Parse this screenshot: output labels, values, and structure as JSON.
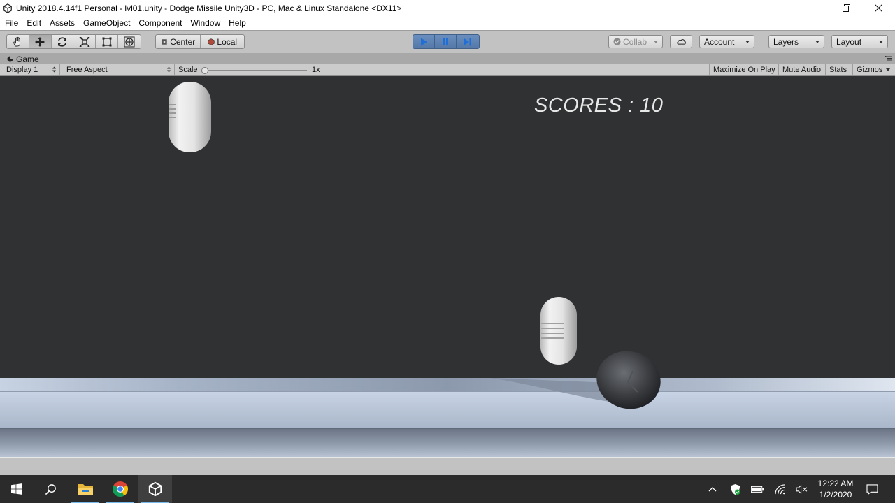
{
  "window": {
    "title": "Unity 2018.4.14f1 Personal - lvl01.unity - Dodge Missile Unity3D - PC, Mac & Linux Standalone <DX11>",
    "app_icon": "unity-icon",
    "controls": [
      "minimize-icon",
      "restore-icon",
      "close-icon"
    ]
  },
  "menu": {
    "items": [
      "File",
      "Edit",
      "Assets",
      "GameObject",
      "Component",
      "Window",
      "Help"
    ]
  },
  "toolbar": {
    "transform_tools": [
      "hand-tool-icon",
      "move-tool-icon",
      "rotate-tool-icon",
      "scale-tool-icon",
      "rect-tool-icon",
      "transform-tool-icon"
    ],
    "active_tool": "move-tool-icon",
    "pivot_center": "Center",
    "pivot_local": "Local",
    "playback": [
      "play-icon",
      "pause-icon",
      "step-icon"
    ],
    "collab": "Collab",
    "account": "Account",
    "layers": "Layers",
    "layout": "Layout",
    "accent": "#5478a8"
  },
  "game_tab": {
    "label": "Game",
    "display": "Display 1",
    "aspect": "Free Aspect",
    "scale_label": "Scale",
    "scale_value": "1x",
    "toggles": [
      "Maximize On Play",
      "Mute Audio",
      "Stats",
      "Gizmos"
    ]
  },
  "game": {
    "score_text": "SCORES : 10",
    "background": "#303133",
    "objects": [
      "missile-capsule",
      "missile-capsule",
      "player-ball",
      "floor-platform"
    ]
  },
  "taskbar": {
    "apps": [
      "windows-start-icon",
      "search-icon",
      "file-explorer-icon",
      "chrome-icon",
      "unity-icon"
    ],
    "tray": [
      "chevron-up-icon",
      "security-shield-icon",
      "battery-icon",
      "wifi-icon",
      "volume-muted-icon",
      "notification-icon"
    ],
    "time": "12:22 AM",
    "date": "1/2/2020"
  }
}
